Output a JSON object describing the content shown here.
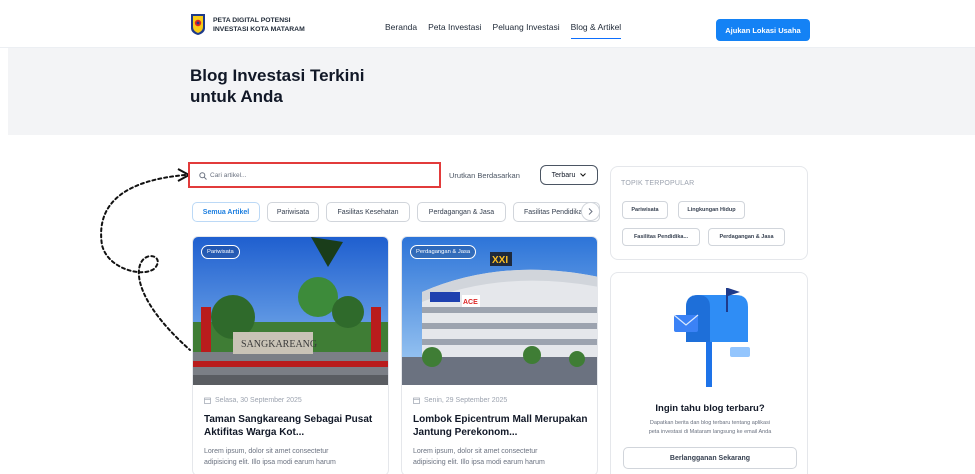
{
  "header": {
    "brand_line1": "PETA DIGITAL POTENSI",
    "brand_line2": "INVESTASI KOTA MATARAM",
    "nav": [
      "Beranda",
      "Peta Investasi",
      "Peluang Investasi",
      "Blog & Artikel"
    ],
    "active_nav": "Blog & Artikel",
    "cta_label": "Ajukan Lokasi Usaha",
    "accent_color": "#1482f5"
  },
  "hero": {
    "title_line1": "Blog Investasi Terkini",
    "title_line2": "untuk Anda"
  },
  "search": {
    "placeholder": "Cari artikel...",
    "icon": "search-icon"
  },
  "sort": {
    "label": "Urutkan Berdasarkan",
    "selected": "Terbaru"
  },
  "chips": [
    "Semua Artikel",
    "Pariwisata",
    "Fasilitas Kesehatan",
    "Perdagangan & Jasa",
    "Fasilitas Pendidikan"
  ],
  "active_chip": "Semua Artikel",
  "articles": [
    {
      "category": "Pariwisata",
      "date": "Selasa, 30 September 2025",
      "title_line1": "Taman Sangkareang Sebagai Pusat",
      "title_line2": "Aktifitas Warga Kot...",
      "body_line1": "Lorem ipsum, dolor sit amet consectetur",
      "body_line2": "adipisicing elit. Illo ipsa modi earum harum",
      "image_sign": "SANGKAREANG"
    },
    {
      "category": "Perdagangan & Jasa",
      "date": "Senin, 29 September 2025",
      "title_line1": "Lombok Epicentrum Mall Merupakan",
      "title_line2": "Jantung Perekonom...",
      "body_line1": "Lorem ipsum, dolor sit amet consectetur",
      "body_line2": "adipisicing elit. Illo ipsa modi earum harum",
      "image_sign": "XXI",
      "image_sign2": "ACE"
    }
  ],
  "topics": {
    "title": "TOPIK TERPOPULAR",
    "tags": [
      "Pariwisata",
      "Lingkungan Hidup",
      "Fasilitas Pendidika...",
      "Perdagangan & Jasa"
    ]
  },
  "subscribe": {
    "title": "Ingin tahu blog terbaru?",
    "desc_line1": "Dapatkan berita dan blog terbaru tentang aplikasi",
    "desc_line2": "peta investasi di Mataram langsung ke email Anda",
    "button_label": "Berlangganan Sekarang"
  }
}
